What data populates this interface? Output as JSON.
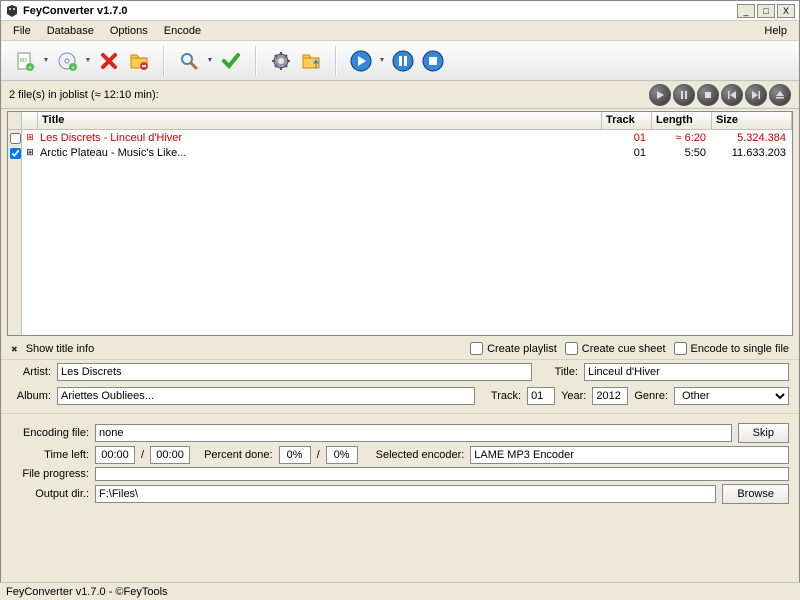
{
  "window": {
    "title": "FeyConverter v1.7.0"
  },
  "menu": {
    "file": "File",
    "database": "Database",
    "options": "Options",
    "encode": "Encode",
    "help": "Help"
  },
  "joblist": {
    "info": "2 file(s) in joblist (≈ 12:10 min):",
    "columns": {
      "title": "Title",
      "track": "Track",
      "length": "Length",
      "size": "Size"
    },
    "rows": [
      {
        "title": "Les Discrets - Linceul d'Hiver",
        "track": "01",
        "length": "≈ 6:20",
        "size": "5.324.384",
        "active": true
      },
      {
        "title": "Arctic Plateau - Music's Like...",
        "track": "01",
        "length": "5:50",
        "size": "11.633.203",
        "active": false
      }
    ]
  },
  "options": {
    "show_title_info": "Show title info",
    "create_playlist": "Create playlist",
    "create_cue_sheet": "Create cue sheet",
    "encode_single": "Encode to single file"
  },
  "meta": {
    "artist_lbl": "Artist:",
    "artist": "Les Discrets",
    "title_lbl": "Title:",
    "title": "Linceul d'Hiver",
    "album_lbl": "Album:",
    "album": "Ariettes Oubliees...",
    "track_lbl": "Track:",
    "track": "01",
    "year_lbl": "Year:",
    "year": "2012",
    "genre_lbl": "Genre:",
    "genre": "Other"
  },
  "encoding": {
    "file_lbl": "Encoding file:",
    "file": "none",
    "skip": "Skip",
    "time_left_lbl": "Time left:",
    "time_elapsed": "00:00",
    "time_total": "00:00",
    "percent_lbl": "Percent done:",
    "percent1": "0%",
    "percent2": "0%",
    "encoder_lbl": "Selected encoder:",
    "encoder": "LAME MP3 Encoder",
    "progress_lbl": "File progress:",
    "output_lbl": "Output dir.:",
    "output": "F:\\Files\\",
    "browse": "Browse"
  },
  "status": "FeyConverter v1.7.0 - ©FeyTools"
}
